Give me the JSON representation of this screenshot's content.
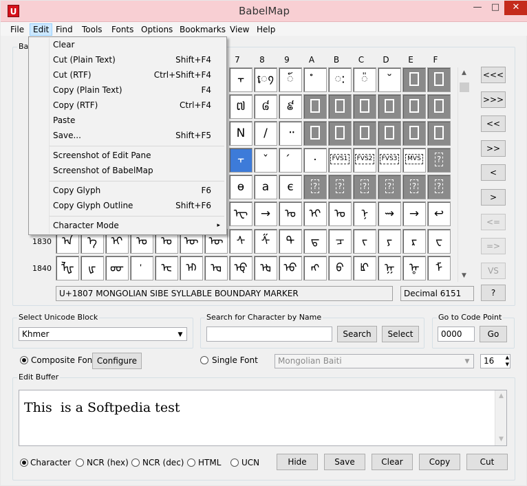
{
  "window": {
    "title": "BabelMap",
    "icon_letter": "U",
    "minimize": "—",
    "maximize": "□",
    "close": "✕"
  },
  "menu": [
    "File",
    "Edit",
    "Find",
    "Tools",
    "Fonts",
    "Options",
    "Bookmarks",
    "View",
    "Help"
  ],
  "edit_menu": {
    "items": [
      {
        "label": "Clear",
        "shortcut": ""
      },
      {
        "label": "Cut (Plain Text)",
        "shortcut": "Shift+F4"
      },
      {
        "label": "Cut (RTF)",
        "shortcut": "Ctrl+Shift+F4"
      },
      {
        "label": "Copy (Plain Text)",
        "shortcut": "F4"
      },
      {
        "label": "Copy (RTF)",
        "shortcut": "Ctrl+F4"
      },
      {
        "label": "Paste",
        "shortcut": ""
      },
      {
        "label": "Save...",
        "shortcut": "Shift+F5"
      },
      {
        "label": "Screenshot of Edit Pane",
        "shortcut": ""
      },
      {
        "label": "Screenshot of BabelMap",
        "shortcut": ""
      },
      {
        "label": "Copy Glyph",
        "shortcut": "F6"
      },
      {
        "label": "Copy Glyph Outline",
        "shortcut": "Shift+F6"
      },
      {
        "label": "Character Mode",
        "shortcut": "▸"
      }
    ]
  },
  "grid": {
    "group_label": "Bas",
    "col_headers": [
      "7",
      "8",
      "9",
      "A",
      "B",
      "C",
      "D",
      "E",
      "F"
    ],
    "row_headers": {
      "r6": "1830",
      "r7": "1840"
    },
    "rows": [
      [
        "᠇",
        "េ᠀",
        "៍",
        "ໍ",
        "ៈ",
        "៉",
        "˘",
        "",
        ""
      ],
      [
        "៧",
        "៨",
        "៩",
        "",
        "",
        "",
        "",
        "",
        ""
      ],
      [
        "N",
        "/",
        "᠃",
        "",
        "",
        "",
        "",
        "",
        ""
      ],
      [
        "᠇",
        "ˇ",
        "́",
        "·",
        "FVS1",
        "FVS2",
        "FVS3",
        "MVS",
        "?"
      ],
      [
        "ѳ",
        "а",
        "є",
        "?",
        "?",
        "?",
        "?",
        "?",
        "?"
      ],
      [
        "ᠧ",
        "→",
        "ᠣ",
        "ᠢ",
        "ᠤ",
        "ᠨ",
        "⇝",
        "→",
        "↩"
      ],
      [
        "ᠰ",
        "ᠱ",
        "ᠲ",
        "ᠳ",
        "ᠴ",
        "ᠵ",
        "ᠶ",
        "ᠷ",
        "ᠸ"
      ],
      [
        "ᡇ",
        "ᡈ",
        "ᡉ",
        "ᡊ",
        "ᡋ",
        "ᡌ",
        "ᡍ",
        "ᡎ",
        "ᡏ"
      ]
    ],
    "row6_left": [
      "ᠠ",
      "ᠡ",
      "ᠢ",
      "ᠣ",
      "ᠤ",
      "ᠥ",
      "ᠦ"
    ],
    "row7_left": [
      "ᡀ",
      "ᡁ",
      "ᡂ",
      "ᡃ",
      "ᡄ",
      "ᡅ",
      "ᡆ"
    ]
  },
  "nav_buttons": [
    "<<<",
    ">>>",
    "<<",
    ">>",
    "<",
    ">",
    "<=",
    "=>",
    "VS",
    "?"
  ],
  "status": {
    "char_name": "U+1807 MONGOLIAN SIBE SYLLABLE BOUNDARY MARKER",
    "decimal": "Decimal 6151"
  },
  "unicode_block": {
    "label": "Select Unicode Block",
    "value": "Khmer"
  },
  "search": {
    "label": "Search for Character by Name",
    "value": "",
    "search_button": "Search",
    "select_button": "Select"
  },
  "goto": {
    "label": "Go to Code Point",
    "value": "0000",
    "button": "Go"
  },
  "font": {
    "composite_label": "Composite Font",
    "configure_button": "Configure",
    "single_label": "Single Font",
    "single_font_value": "Mongolian Baiti",
    "size_value": "16"
  },
  "edit_buffer": {
    "label": "Edit Buffer",
    "text": "This  is a Softpedia test"
  },
  "output_modes": [
    "Character",
    "NCR (hex)",
    "NCR (dec)",
    "HTML",
    "UCN"
  ],
  "buffer_buttons": [
    "Hide",
    "Save",
    "Clear",
    "Copy",
    "Cut"
  ]
}
